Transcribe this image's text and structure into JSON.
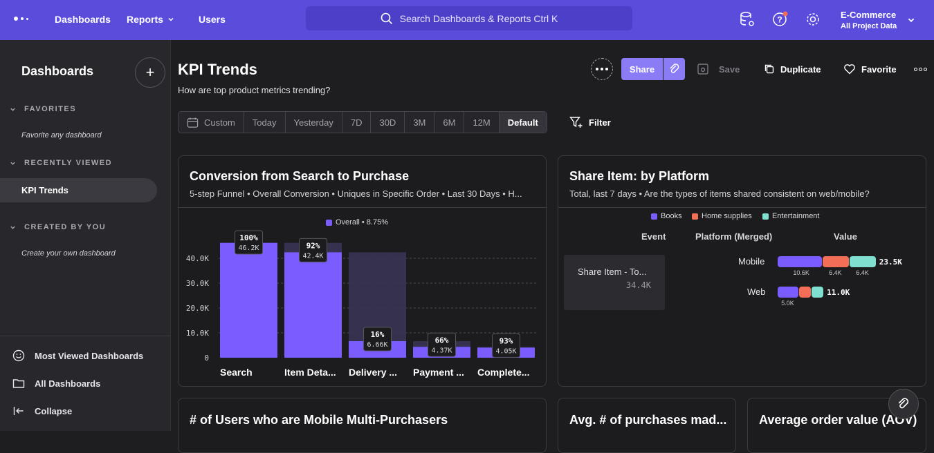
{
  "topbar": {
    "nav": [
      "Dashboards",
      "Reports",
      "Users"
    ],
    "search_placeholder": "Search Dashboards & Reports Ctrl K",
    "project_name": "E-Commerce",
    "project_sub": "All Project Data"
  },
  "sidebar": {
    "title": "Dashboards",
    "favorites_label": "FAVORITES",
    "favorites_empty": "Favorite any dashboard",
    "recent_label": "RECENTLY VIEWED",
    "recent_item": "KPI Trends",
    "created_label": "CREATED BY YOU",
    "created_empty": "Create your own dashboard",
    "bottom": [
      "Most Viewed Dashboards",
      "All Dashboards",
      "Collapse"
    ]
  },
  "header": {
    "title": "KPI Trends",
    "subtitle": "How are top product metrics trending?",
    "share": "Share",
    "save": "Save",
    "duplicate": "Duplicate",
    "favorite": "Favorite"
  },
  "date_ranges": [
    "Custom",
    "Today",
    "Yesterday",
    "7D",
    "30D",
    "3M",
    "6M",
    "12M",
    "Default"
  ],
  "selected_range": "Default",
  "filter_label": "Filter",
  "funnel": {
    "title": "Conversion from Search to Purchase",
    "subtitle": "5-step Funnel • Overall Conversion • Uniques in Specific Order • Last 30 Days • H...",
    "legend": "Overall • 8.75%"
  },
  "chart_data": {
    "type": "bar",
    "categories": [
      "Search",
      "Item Deta...",
      "Delivery ...",
      "Payment ...",
      "Complete..."
    ],
    "values": [
      46200,
      42400,
      6660,
      4370,
      4050
    ],
    "value_labels": [
      "46.2K",
      "42.4K",
      "6.66K",
      "4.37K",
      "4.05K"
    ],
    "pct_labels": [
      "100%",
      "92%",
      "16%",
      "66%",
      "93%"
    ],
    "ghost_values": [
      46200,
      46200,
      42400,
      6660,
      4370
    ],
    "yticks": [
      "0",
      "10.0K",
      "20.0K",
      "30.0K",
      "40.0K"
    ],
    "ylim": [
      0,
      50000
    ],
    "colors": {
      "bar": "#7b5cff",
      "ghost": "#3a3557"
    }
  },
  "platform": {
    "title": "Share Item: by Platform",
    "subtitle": "Total, last 7 days • Are the types of items shared consistent on web/mobile?",
    "legend": [
      {
        "name": "Books",
        "color": "#7b5cff"
      },
      {
        "name": "Home supplies",
        "color": "#f26e56"
      },
      {
        "name": "Entertainment",
        "color": "#7fe0d0"
      }
    ],
    "col_event": "Event",
    "col_platform": "Platform (Merged)",
    "col_value": "Value",
    "event_name": "Share Item - To...",
    "event_value": "34.4K",
    "rows": [
      {
        "platform": "Mobile",
        "total": "23.5K",
        "segments": [
          {
            "value": 10.6,
            "label": "10.6K"
          },
          {
            "value": 6.4,
            "label": "6.4K"
          },
          {
            "value": 6.4,
            "label": "6.4K"
          }
        ]
      },
      {
        "platform": "Web",
        "total": "11.0K",
        "segments": [
          {
            "value": 5.0,
            "label": "5.0K"
          },
          {
            "value": 3.0,
            "label": ""
          },
          {
            "value": 3.0,
            "label": ""
          }
        ]
      }
    ]
  },
  "bottom_cards": [
    "# of Users who are Mobile Multi-Purchasers",
    "Avg. # of purchases mad...",
    "Average order value (AOV)"
  ]
}
